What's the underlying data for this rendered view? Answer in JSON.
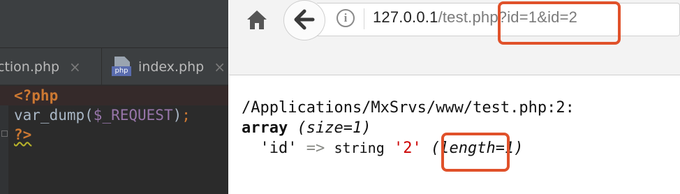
{
  "ide": {
    "tabs": [
      {
        "label": "ction.php",
        "close": "×",
        "icon": "none"
      },
      {
        "label": "index.php",
        "close": "×",
        "icon": "php-file-icon",
        "icon_label": "php"
      }
    ],
    "code": {
      "line1": "<?php",
      "line2_fn": "var_dump(",
      "line2_var": "$_REQUEST",
      "line2_close": ")",
      "line2_semi": ";",
      "line3": "?>"
    }
  },
  "browser": {
    "url_host": "127.0.0.1",
    "url_path": "/test.php?id=1&id=2",
    "info_glyph": "i",
    "highlight_color": "#e0512a"
  },
  "output": {
    "path_line": "/Applications/MxSrvs/www/test.php:2:",
    "array_kw": "array",
    "size_text": "(size=1)",
    "key": "'id'",
    "arrow": "=>",
    "type_word": "string",
    "value": "'2'",
    "length_text": "(length=1)"
  }
}
